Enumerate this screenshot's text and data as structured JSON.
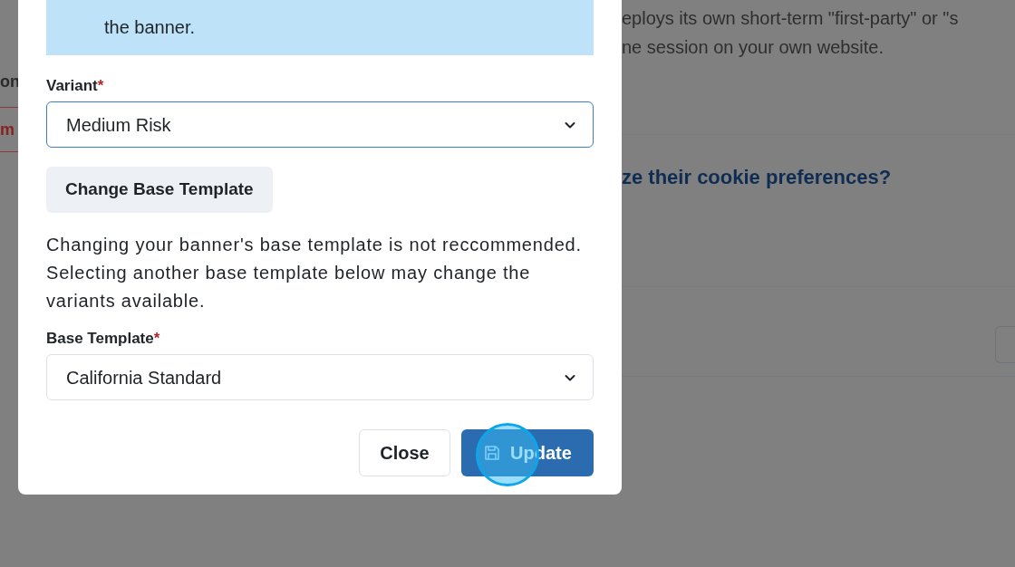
{
  "background": {
    "left_texts": [
      {
        "text": "on",
        "kind": "heading"
      },
      {
        "text": "m",
        "kind": "link"
      }
    ],
    "description_lines": [
      "eploys its own short-term \"first-party\" or \"s",
      "ne session on your own website."
    ],
    "question": "ze their cookie preferences?"
  },
  "dialog": {
    "notice": "the banner.",
    "variant": {
      "label": "Variant",
      "mark": "*",
      "value": "Medium Risk",
      "focused": true
    },
    "change_button": "Change Base Template",
    "warning": "Changing your banner's base template is not reccommended. Selecting another base template below may change the variants available.",
    "base_template": {
      "label": "Base Template",
      "mark": "*",
      "value": "California Standard",
      "focused": false
    },
    "buttons": [
      {
        "label": "Close",
        "kind": "secondary"
      },
      {
        "label": "Update",
        "kind": "primary"
      }
    ]
  }
}
